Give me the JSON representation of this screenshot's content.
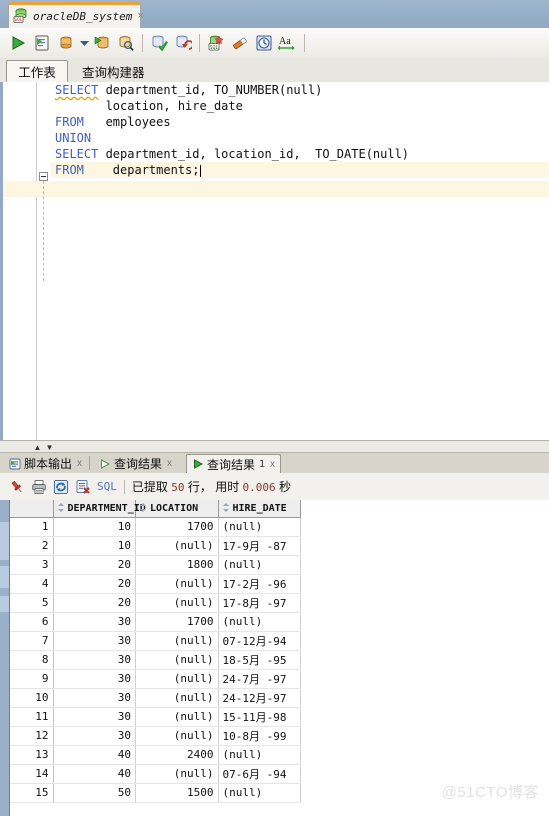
{
  "connection_tab": {
    "label": "oracleDB_system",
    "close": "×",
    "icon": "database-sql-icon"
  },
  "toolbar": {
    "items": [
      {
        "name": "run-statement-button",
        "icon": "green-play-triangle-icon"
      },
      {
        "name": "run-script-button",
        "icon": "script-run-icon"
      },
      {
        "name": "explain-plan-button",
        "icon": "explain-plan-icon"
      },
      {
        "name": "explain-plan-dropdown",
        "icon": "chevron-down-icon"
      },
      {
        "name": "autotrace-button",
        "icon": "autotrace-icon"
      },
      {
        "name": "sql-tuning-advisor-button",
        "icon": "magnifier-database-icon"
      },
      {
        "name": "commit-button",
        "icon": "commit-check-icon"
      },
      {
        "name": "rollback-button",
        "icon": "rollback-icon"
      },
      {
        "name": "unshared-sql-worksheet-button",
        "icon": "new-sql-worksheet-icon"
      },
      {
        "name": "clear-worksheet-button",
        "icon": "eraser-icon"
      },
      {
        "name": "sql-history-button",
        "icon": "clock-history-icon"
      },
      {
        "name": "to-upper-lower-case-button",
        "icon": "aa-case-icon"
      }
    ]
  },
  "worksheet_tabs": [
    {
      "label": "工作表",
      "selected": true
    },
    {
      "label": "查询构建器",
      "selected": false
    }
  ],
  "editor": {
    "lines": [
      {
        "id": "l1",
        "current": false,
        "tokens": [
          {
            "t": "SELECT",
            "c": "kw-u"
          },
          {
            "t": " department_id, ",
            "c": "ident"
          },
          {
            "t": "TO_NUMBER",
            "c": "fn"
          },
          {
            "t": "(null)",
            "c": "ident"
          }
        ]
      },
      {
        "id": "l2",
        "current": false,
        "tokens": [
          {
            "t": "       location, hire_date",
            "c": "ident"
          }
        ]
      },
      {
        "id": "l3",
        "current": false,
        "tokens": [
          {
            "t": "FROM",
            "c": "kw"
          },
          {
            "t": "   employees",
            "c": "ident"
          }
        ]
      },
      {
        "id": "l4",
        "current": false,
        "tokens": [
          {
            "t": "UNION",
            "c": "kw"
          }
        ]
      },
      {
        "id": "l5",
        "current": false,
        "tokens": [
          {
            "t": "SELECT",
            "c": "kw"
          },
          {
            "t": " department_id, location_id,  ",
            "c": "ident"
          },
          {
            "t": "TO_DATE",
            "c": "fn"
          },
          {
            "t": "(null)",
            "c": "ident"
          }
        ]
      },
      {
        "id": "l6",
        "current": true,
        "tokens": [
          {
            "t": "FROM",
            "c": "kw"
          },
          {
            "t": "    departments;",
            "c": "ident"
          }
        ]
      }
    ]
  },
  "result_tabs": [
    {
      "label": "脚本输出",
      "icon": "script-output-icon",
      "selected": false,
      "closable": true,
      "badge": ""
    },
    {
      "label": "查询结果",
      "icon": "query-result-icon",
      "selected": false,
      "closable": true,
      "badge": ""
    },
    {
      "label": "查询结果",
      "icon": "query-result-icon",
      "selected": true,
      "closable": true,
      "badge": "1"
    }
  ],
  "result_toolbar": {
    "items": [
      {
        "name": "pin-button",
        "icon": "red-pin-icon"
      },
      {
        "name": "print-button",
        "icon": "printer-icon"
      },
      {
        "name": "refresh-button",
        "icon": "refresh-arrows-icon"
      },
      {
        "name": "cancel-fetch-button",
        "icon": "stop-fetch-icon"
      }
    ],
    "sql_label": "SQL",
    "status_prefix": "已提取",
    "status_rows": "50",
    "status_rows_unit": "行，",
    "status_time_prefix": "用时",
    "status_time": "0.006",
    "status_time_unit": "秒"
  },
  "grid": {
    "row_header": "",
    "columns": [
      {
        "label": "DEPARTMENT_ID",
        "icon": "column-sort-icon"
      },
      {
        "label": "LOCATION",
        "icon": "column-sort-icon"
      },
      {
        "label": "HIRE_DATE",
        "icon": "column-sort-icon"
      }
    ],
    "rows": [
      {
        "n": "1",
        "department_id": "10",
        "location": "1700",
        "hire_date": "(null)"
      },
      {
        "n": "2",
        "department_id": "10",
        "location": "(null)",
        "hire_date": "17-9月 -87"
      },
      {
        "n": "3",
        "department_id": "20",
        "location": "1800",
        "hire_date": "(null)"
      },
      {
        "n": "4",
        "department_id": "20",
        "location": "(null)",
        "hire_date": "17-2月 -96"
      },
      {
        "n": "5",
        "department_id": "20",
        "location": "(null)",
        "hire_date": "17-8月 -97"
      },
      {
        "n": "6",
        "department_id": "30",
        "location": "1700",
        "hire_date": "(null)"
      },
      {
        "n": "7",
        "department_id": "30",
        "location": "(null)",
        "hire_date": "07-12月-94"
      },
      {
        "n": "8",
        "department_id": "30",
        "location": "(null)",
        "hire_date": "18-5月 -95"
      },
      {
        "n": "9",
        "department_id": "30",
        "location": "(null)",
        "hire_date": "24-7月 -97"
      },
      {
        "n": "10",
        "department_id": "30",
        "location": "(null)",
        "hire_date": "24-12月-97"
      },
      {
        "n": "11",
        "department_id": "30",
        "location": "(null)",
        "hire_date": "15-11月-98"
      },
      {
        "n": "12",
        "department_id": "30",
        "location": "(null)",
        "hire_date": "10-8月 -99"
      },
      {
        "n": "13",
        "department_id": "40",
        "location": "2400",
        "hire_date": "(null)"
      },
      {
        "n": "14",
        "department_id": "40",
        "location": "(null)",
        "hire_date": "07-6月 -94"
      },
      {
        "n": "15",
        "department_id": "50",
        "location": "1500",
        "hire_date": "(null)"
      }
    ]
  },
  "watermark": "@51CTO博客",
  "colors": {
    "titlebar": "#8fa8c4",
    "tab_accent": "#e8a33d",
    "keyword": "#3f5fbf",
    "current_line": "#fdf6e0",
    "status_number": "#8b3a2e",
    "rail": "#9aafc8"
  }
}
